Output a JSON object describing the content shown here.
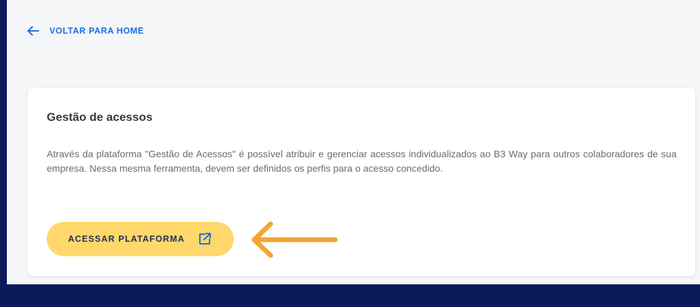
{
  "nav": {
    "back_label": "VOLTAR PARA HOME"
  },
  "card": {
    "title": "Gestão de acessos",
    "description": "Através da plataforma \"Gestão de Acessos\" é possível atribuir e gerenciar acessos individualizados ao B3 Way para outros colaboradores de sua empresa. Nessa mesma ferramenta, devem ser definidos os perfis para o acesso concedido.",
    "button_label": "ACESSAR PLATAFORMA",
    "button_icon": "external-link-icon"
  },
  "annotation": {
    "icon": "arrow-left-icon",
    "color": "#f4a533"
  },
  "colors": {
    "frame": "#0c1a5c",
    "page_background": "#f5f6f8",
    "link": "#1d6fe0",
    "button_background": "#ffd76a",
    "button_text": "#1f2f5c"
  }
}
